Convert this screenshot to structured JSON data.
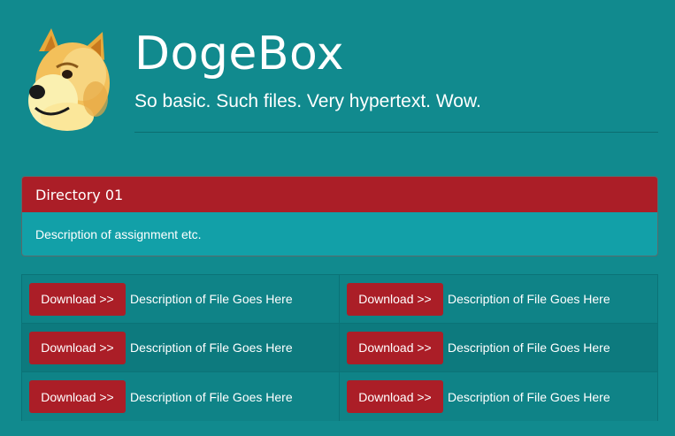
{
  "header": {
    "title": "DogeBox",
    "subtitle": "So basic. Such files. Very hypertext. Wow.",
    "logo_icon": "doge-icon"
  },
  "panel": {
    "heading": "Directory 01",
    "body": "Description of assignment etc."
  },
  "files": [
    {
      "button_label": "Download >>",
      "description": "Description of File Goes Here"
    },
    {
      "button_label": "Download >>",
      "description": "Description of File Goes Here"
    },
    {
      "button_label": "Download >>",
      "description": "Description of File Goes Here"
    },
    {
      "button_label": "Download >>",
      "description": "Description of File Goes Here"
    },
    {
      "button_label": "Download >>",
      "description": "Description of File Goes Here"
    },
    {
      "button_label": "Download >>",
      "description": "Description of File Goes Here"
    }
  ],
  "colors": {
    "background": "#118a8e",
    "accent_red": "#ab1e27",
    "panel_body": "#12a0a8"
  }
}
